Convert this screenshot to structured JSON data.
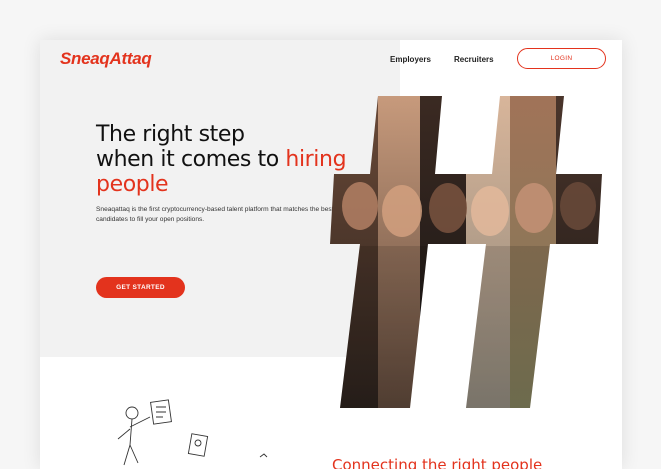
{
  "brand": {
    "logo": "SneaqAttaq",
    "accent": "#e3331d"
  },
  "nav": {
    "employers": "Employers",
    "recruiters": "Recruiters",
    "login": "LOGIN"
  },
  "hero": {
    "line1": "The right step",
    "line2": "when it comes to ",
    "line2_accent": "hiring",
    "line3_accent": "people",
    "description": "Sneaqattaq is the first  cryptocurrency-based talent platform that matches the best candidates to fill your open positions.",
    "cta": "GET STARTED",
    "image": "hashtag-collage-of-faces"
  },
  "section2": {
    "title_partial": "Connecting the right people"
  },
  "icons": {
    "illustration": "sketch-person-with-documents"
  }
}
